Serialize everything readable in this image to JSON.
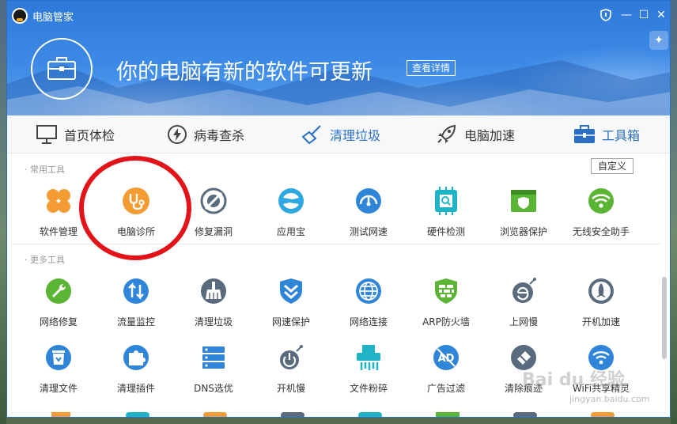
{
  "app": {
    "title": "电脑管家"
  },
  "window_controls": {
    "shield": "shield-icon",
    "minimize": "—",
    "maximize": "☐",
    "close": "✕"
  },
  "header": {
    "headline": "你的电脑有新的软件可更新",
    "details_button": "查看详情"
  },
  "nav": {
    "items": [
      {
        "label": "首页体检",
        "icon": "monitor-icon"
      },
      {
        "label": "病毒查杀",
        "icon": "lightning-icon"
      },
      {
        "label": "清理垃圾",
        "icon": "broom-icon"
      },
      {
        "label": "电脑加速",
        "icon": "rocket-icon"
      },
      {
        "label": "工具箱",
        "icon": "toolbox-icon"
      }
    ]
  },
  "common_tools": {
    "title": "· 常用工具",
    "custom_button": "自定义",
    "items": [
      {
        "label": "软件管理",
        "icon": "clover-icon",
        "color": "#f39c33"
      },
      {
        "label": "电脑诊所",
        "icon": "stethoscope-icon",
        "color": "#f39c33"
      },
      {
        "label": "修复漏洞",
        "icon": "shield-repair-icon",
        "color": "#5a6b7d"
      },
      {
        "label": "应用宝",
        "icon": "appstore-icon",
        "color": "#2fa7e0"
      },
      {
        "label": "测试网速",
        "icon": "speedometer-icon",
        "color": "#2f86d8"
      },
      {
        "label": "硬件检测",
        "icon": "chip-icon",
        "color": "#1eb4c6"
      },
      {
        "label": "浏览器保护",
        "icon": "browser-shield-icon",
        "color": "#5bb534"
      },
      {
        "label": "无线安全助手",
        "icon": "wifi-icon",
        "color": "#5bb534"
      }
    ]
  },
  "more_tools": {
    "title": "· 更多工具",
    "rows": [
      [
        {
          "label": "网络修复",
          "icon": "wrench-icon",
          "color": "#5bb534"
        },
        {
          "label": "流量监控",
          "icon": "updown-arrows-icon",
          "color": "#2f86d8"
        },
        {
          "label": "清理垃圾",
          "icon": "broom-icon",
          "color": "#5a6b7d"
        },
        {
          "label": "网速保护",
          "icon": "chevron-shield-icon",
          "color": "#2f86d8"
        },
        {
          "label": "网络连接",
          "icon": "globe-icon",
          "color": "#2f86d8"
        },
        {
          "label": "ARP防火墙",
          "icon": "firewall-icon",
          "color": "#5bb534"
        },
        {
          "label": "上网慢",
          "icon": "globe-bug-icon",
          "color": "#5a6b7d"
        },
        {
          "label": "开机加速",
          "icon": "rocket-icon",
          "color": "#5a6b7d"
        }
      ],
      [
        {
          "label": "清理文件",
          "icon": "trash-icon",
          "color": "#2f86d8"
        },
        {
          "label": "清理插件",
          "icon": "puzzle-icon",
          "color": "#2f86d8"
        },
        {
          "label": "DNS选优",
          "icon": "server-icon",
          "color": "#2f86d8"
        },
        {
          "label": "开机慢",
          "icon": "power-bug-icon",
          "color": "#5a6b7d"
        },
        {
          "label": "文件粉碎",
          "icon": "shredder-icon",
          "color": "#1eb4c6"
        },
        {
          "label": "广告过滤",
          "icon": "ad-block-icon",
          "color": "#2f86d8"
        },
        {
          "label": "清除痕迹",
          "icon": "eraser-icon",
          "color": "#5a6b7d"
        },
        {
          "label": "WiFi共享精灵",
          "icon": "wifi-share-icon",
          "color": "#2f86d8"
        }
      ]
    ]
  },
  "watermark": {
    "text": "Bai du 经验",
    "sub": "jingyan.baidu.com"
  }
}
